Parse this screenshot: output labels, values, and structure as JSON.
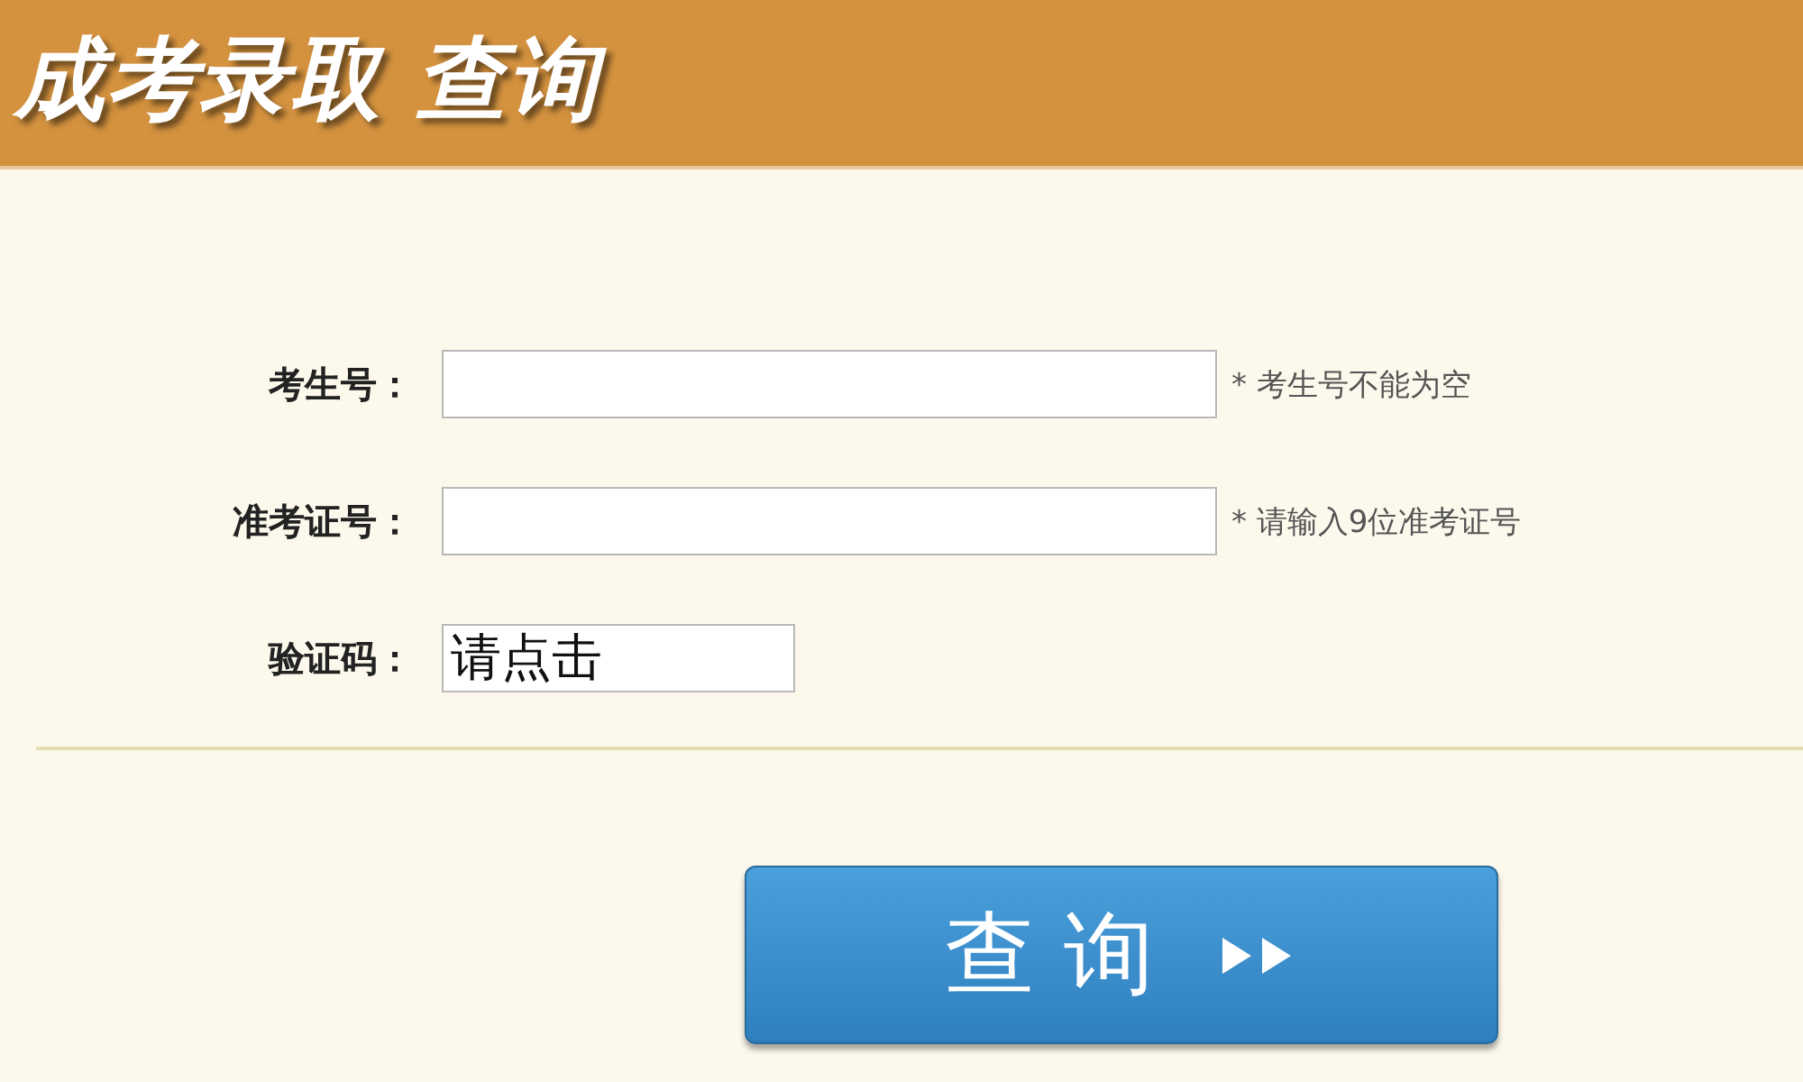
{
  "header": {
    "title": "成考录取 查询"
  },
  "form": {
    "fields": [
      {
        "label": "考生号：",
        "kind": "text",
        "hint": "* 考生号不能为空"
      },
      {
        "label": "准考证号：",
        "kind": "text",
        "hint": "* 请输入9位准考证号"
      },
      {
        "label": "验证码：",
        "kind": "captcha",
        "value": "请点击"
      }
    ]
  },
  "submit_button": {
    "label": "查 询"
  }
}
